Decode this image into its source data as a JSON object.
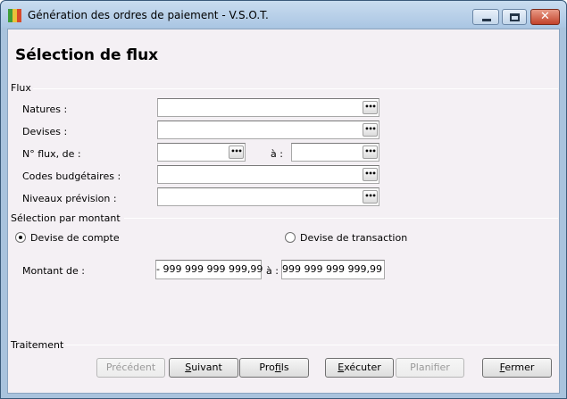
{
  "window": {
    "title": "Génération des ordres de paiement - V.S.O.T.",
    "close_glyph": "✕"
  },
  "page": {
    "heading": "Sélection de flux"
  },
  "flux": {
    "group_title": "Flux",
    "natures_label": "Natures :",
    "devises_label": "Devises :",
    "nflux_label": "N° flux, de :",
    "a_label": "à :",
    "codes_label": "Codes budgétaires :",
    "niveaux_label": "Niveaux prévision :",
    "ellipsis": "•••"
  },
  "montant": {
    "group_title": "Sélection par montant",
    "radio_compte": "Devise de compte",
    "radio_transaction": "Devise de transaction",
    "selected": "compte",
    "montant_label": "Montant",
    "de_label": "de :",
    "a_label": "à :",
    "min_value": "- 999 999 999 999,99",
    "max_value": "999 999 999 999,99"
  },
  "traitement": {
    "group_title": "Traitement"
  },
  "buttons": {
    "precedent": {
      "u": "",
      "rest": "Précédent"
    },
    "suivant": {
      "u": "S",
      "rest": "uivant"
    },
    "profils": {
      "pre": "Pro",
      "u": "f",
      "rest": "ils"
    },
    "executer": {
      "u": "E",
      "rest": "xécuter"
    },
    "planifier": {
      "u": "",
      "rest": "Planifier"
    },
    "fermer": {
      "u": "F",
      "rest": "ermer"
    }
  },
  "colors": {
    "titlebar": "#aac6e3",
    "client_bg": "#f4f0f4",
    "close_button": "#c2432b"
  },
  "icons": [
    "app-icon",
    "minimize-icon",
    "maximize-icon",
    "close-icon",
    "ellipsis-icon"
  ]
}
